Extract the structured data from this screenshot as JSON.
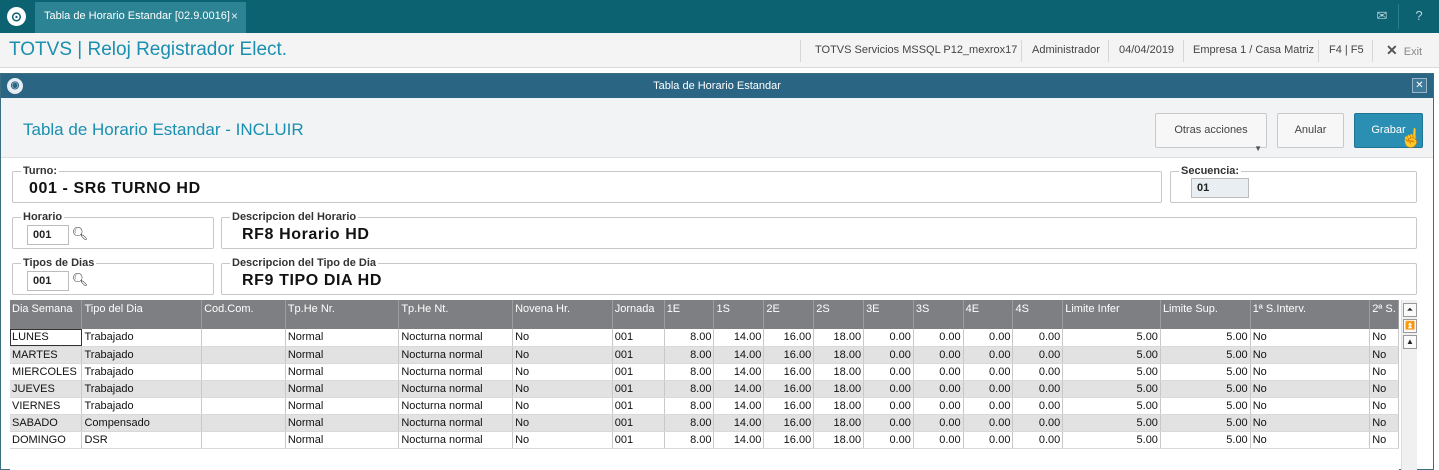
{
  "tabbar": {
    "tab_title": "Tabla de Horario Estandar [02.9.0016]",
    "tab_close": "×",
    "mail_icon": "mail-icon",
    "help_icon": "help-icon"
  },
  "header": {
    "app_title": "TOTVS | Reloj Registrador Elect.",
    "server": "TOTVS Servicios MSSQL P12_mexrox17",
    "user": "Administrador",
    "date": "04/04/2019",
    "company": "Empresa 1 / Casa Matriz",
    "keys": "F4 | F5",
    "exit_label": "Exit"
  },
  "dialog": {
    "title": "Tabla de Horario Estandar",
    "heading": "Tabla de Horario Estandar - INCLUIR",
    "buttons": {
      "other_actions": "Otras acciones",
      "cancel": "Anular",
      "save": "Grabar"
    }
  },
  "form": {
    "turno_label": "Turno:",
    "turno_value": "001 - SR6 TURNO HD",
    "secuencia_label": "Secuencia:",
    "secuencia_value": "01",
    "horario_label": "Horario",
    "horario_value": "001",
    "desc_horario_label": "Descripcion del Horario",
    "desc_horario_value": "RF8 Horario HD",
    "tipos_dias_label": "Tipos de Dias",
    "tipos_dias_value": "001",
    "desc_tipo_dia_label": "Descripcion del Tipo de Dia",
    "desc_tipo_dia_value": "RF9 TIPO DIA HD"
  },
  "grid": {
    "columns": [
      "Dia Semana",
      "Tipo del Dia",
      "Cod.Com.",
      "Tp.He Nr.",
      "Tp.He Nt.",
      "Novena Hr.",
      "Jornada",
      "1E",
      "1S",
      "2E",
      "2S",
      "3E",
      "3S",
      "4E",
      "4S",
      "Limite Infer",
      "Limite Sup.",
      "1ª S.Interv.",
      "2ª S."
    ],
    "rows": [
      [
        "LUNES",
        "Trabajado",
        "",
        "Normal",
        "Nocturna normal",
        "No",
        "001",
        "8.00",
        "14.00",
        "16.00",
        "18.00",
        "0.00",
        "0.00",
        "0.00",
        "0.00",
        "5.00",
        "5.00",
        "No",
        "No"
      ],
      [
        "MARTES",
        "Trabajado",
        "",
        "Normal",
        "Nocturna normal",
        "No",
        "001",
        "8.00",
        "14.00",
        "16.00",
        "18.00",
        "0.00",
        "0.00",
        "0.00",
        "0.00",
        "5.00",
        "5.00",
        "No",
        "No"
      ],
      [
        "MIERCOLES",
        "Trabajado",
        "",
        "Normal",
        "Nocturna normal",
        "No",
        "001",
        "8.00",
        "14.00",
        "16.00",
        "18.00",
        "0.00",
        "0.00",
        "0.00",
        "0.00",
        "5.00",
        "5.00",
        "No",
        "No"
      ],
      [
        "JUEVES",
        "Trabajado",
        "",
        "Normal",
        "Nocturna normal",
        "No",
        "001",
        "8.00",
        "14.00",
        "16.00",
        "18.00",
        "0.00",
        "0.00",
        "0.00",
        "0.00",
        "5.00",
        "5.00",
        "No",
        "No"
      ],
      [
        "VIERNES",
        "Trabajado",
        "",
        "Normal",
        "Nocturna normal",
        "No",
        "001",
        "8.00",
        "14.00",
        "16.00",
        "18.00",
        "0.00",
        "0.00",
        "0.00",
        "0.00",
        "5.00",
        "5.00",
        "No",
        "No"
      ],
      [
        "SABADO",
        "Compensado",
        "",
        "Normal",
        "Nocturna normal",
        "No",
        "001",
        "8.00",
        "14.00",
        "16.00",
        "18.00",
        "0.00",
        "0.00",
        "0.00",
        "0.00",
        "5.00",
        "5.00",
        "No",
        "No"
      ],
      [
        "DOMINGO",
        "DSR",
        "",
        "Normal",
        "Nocturna normal",
        "No",
        "001",
        "8.00",
        "14.00",
        "16.00",
        "18.00",
        "0.00",
        "0.00",
        "0.00",
        "0.00",
        "5.00",
        "5.00",
        "No",
        "No"
      ]
    ]
  }
}
